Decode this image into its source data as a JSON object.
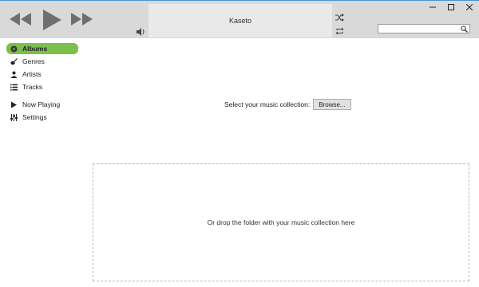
{
  "player": {
    "now_playing": "Kaseto",
    "prev_icon": "rewind-icon",
    "play_icon": "play-icon",
    "next_icon": "fast-forward-icon",
    "volume_icon": "volume-icon",
    "shuffle_icon": "shuffle-icon",
    "repeat_icon": "repeat-icon"
  },
  "search": {
    "value": "",
    "placeholder": "",
    "icon": "search-icon"
  },
  "window": {
    "minimize": "minimize-icon",
    "maximize": "maximize-icon",
    "close": "close-icon"
  },
  "sidebar": {
    "items": [
      {
        "label": "Albums",
        "icon": "disc-icon",
        "active": true
      },
      {
        "label": "Genres",
        "icon": "guitar-icon",
        "active": false
      },
      {
        "label": "Artists",
        "icon": "person-icon",
        "active": false
      },
      {
        "label": "Tracks",
        "icon": "list-icon",
        "active": false
      },
      {
        "label": "Now Playing",
        "icon": "play-arrow-icon",
        "active": false
      },
      {
        "label": "Settings",
        "icon": "sliders-icon",
        "active": false
      }
    ]
  },
  "main": {
    "collection_label": "Select your music collection:",
    "browse_label": "Browse...",
    "drop_text": "Or drop the folder with your music collection here"
  },
  "colors": {
    "accent": "#7cc04a",
    "topbar": "#d9d9d9",
    "titlebar_line": "#4a90d9"
  }
}
